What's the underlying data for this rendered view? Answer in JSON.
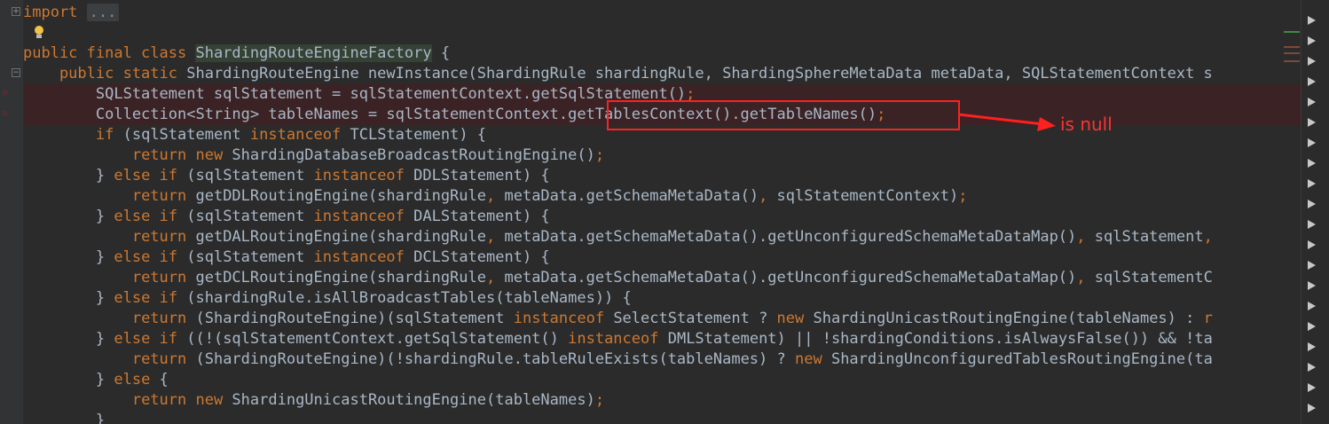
{
  "annotation": {
    "label": "is null",
    "color": "#ff2020"
  },
  "lines": [
    [
      [
        "import ",
        "kw"
      ],
      [
        "...",
        "fold"
      ]
    ],
    [],
    [
      [
        "public final class ",
        "kw"
      ],
      [
        "ShardingRouteEngineFactory",
        "hl"
      ],
      [
        " {",
        ""
      ]
    ],
    [
      [
        "    public static ",
        "kw"
      ],
      [
        "ShardingRouteEngine newInstance(ShardingRule shardingRule, ShardingSphereMetaData metaData, SQLStatementContext s",
        ""
      ]
    ],
    [
      [
        "        SQLStatement sqlStatement = sqlStatementContext.getSqlStatement()",
        ""
      ],
      [
        ";",
        "kw"
      ]
    ],
    [
      [
        "        Collection<String> tableNames = sqlStatementContext.getTablesContext().getTableNames()",
        ""
      ],
      [
        ";",
        "kw"
      ]
    ],
    [
      [
        "        ",
        ""
      ],
      [
        "if ",
        "kw"
      ],
      [
        "(sqlStatement ",
        ""
      ],
      [
        "instanceof ",
        "kw"
      ],
      [
        "TCLStatement) {",
        ""
      ]
    ],
    [
      [
        "            ",
        ""
      ],
      [
        "return new ",
        "kw"
      ],
      [
        "ShardingDatabaseBroadcastRoutingEngine()",
        ""
      ],
      [
        ";",
        "kw"
      ]
    ],
    [
      [
        "        } ",
        ""
      ],
      [
        "else if ",
        "kw"
      ],
      [
        "(sqlStatement ",
        ""
      ],
      [
        "instanceof ",
        "kw"
      ],
      [
        "DDLStatement) {",
        ""
      ]
    ],
    [
      [
        "            ",
        ""
      ],
      [
        "return ",
        "kw"
      ],
      [
        "getDDLRoutingEngine(shardingRule",
        ""
      ],
      [
        ", ",
        "kw"
      ],
      [
        "metaData.getSchemaMetaData()",
        ""
      ],
      [
        ", ",
        "kw"
      ],
      [
        "sqlStatementContext)",
        ""
      ],
      [
        ";",
        "kw"
      ]
    ],
    [
      [
        "        } ",
        ""
      ],
      [
        "else if ",
        "kw"
      ],
      [
        "(sqlStatement ",
        ""
      ],
      [
        "instanceof ",
        "kw"
      ],
      [
        "DALStatement) {",
        ""
      ]
    ],
    [
      [
        "            ",
        ""
      ],
      [
        "return ",
        "kw"
      ],
      [
        "getDALRoutingEngine(shardingRule",
        ""
      ],
      [
        ", ",
        "kw"
      ],
      [
        "metaData.getSchemaMetaData().getUnconfiguredSchemaMetaDataMap()",
        ""
      ],
      [
        ", ",
        "kw"
      ],
      [
        "sqlStatement",
        ""
      ],
      [
        ",",
        "kw"
      ]
    ],
    [
      [
        "        } ",
        ""
      ],
      [
        "else if ",
        "kw"
      ],
      [
        "(sqlStatement ",
        ""
      ],
      [
        "instanceof ",
        "kw"
      ],
      [
        "DCLStatement) {",
        ""
      ]
    ],
    [
      [
        "            ",
        ""
      ],
      [
        "return ",
        "kw"
      ],
      [
        "getDCLRoutingEngine(shardingRule",
        ""
      ],
      [
        ", ",
        "kw"
      ],
      [
        "metaData.getSchemaMetaData().getUnconfiguredSchemaMetaDataMap()",
        ""
      ],
      [
        ", ",
        "kw"
      ],
      [
        "sqlStatementC",
        ""
      ]
    ],
    [
      [
        "        } ",
        ""
      ],
      [
        "else if ",
        "kw"
      ],
      [
        "(shardingRule.isAllBroadcastTables(tableNames)) {",
        ""
      ]
    ],
    [
      [
        "            ",
        ""
      ],
      [
        "return ",
        "kw"
      ],
      [
        "(ShardingRouteEngine)(sqlStatement ",
        ""
      ],
      [
        "instanceof ",
        "kw"
      ],
      [
        "SelectStatement ? ",
        ""
      ],
      [
        "new ",
        "kw"
      ],
      [
        "ShardingUnicastRoutingEngine(tableNames) : ",
        ""
      ],
      [
        "r",
        "kw"
      ]
    ],
    [
      [
        "        } ",
        ""
      ],
      [
        "else if ",
        "kw"
      ],
      [
        "((!(sqlStatementContext.getSqlStatement() ",
        ""
      ],
      [
        "instanceof ",
        "kw"
      ],
      [
        "DMLStatement) || !shardingConditions.isAlwaysFalse()) && !ta",
        ""
      ]
    ],
    [
      [
        "            ",
        ""
      ],
      [
        "return ",
        "kw"
      ],
      [
        "(ShardingRouteEngine)(!shardingRule.tableRuleExists(tableNames) ? ",
        ""
      ],
      [
        "new ",
        "kw"
      ],
      [
        "ShardingUnconfiguredTablesRoutingEngine(ta",
        ""
      ]
    ],
    [
      [
        "        } ",
        ""
      ],
      [
        "else ",
        "kw"
      ],
      [
        "{",
        ""
      ]
    ],
    [
      [
        "            ",
        ""
      ],
      [
        "return new ",
        "kw"
      ],
      [
        "ShardingUnicastRoutingEngine(tableNames)",
        ""
      ],
      [
        ";",
        "kw"
      ]
    ],
    [
      [
        "        }",
        ""
      ]
    ]
  ]
}
